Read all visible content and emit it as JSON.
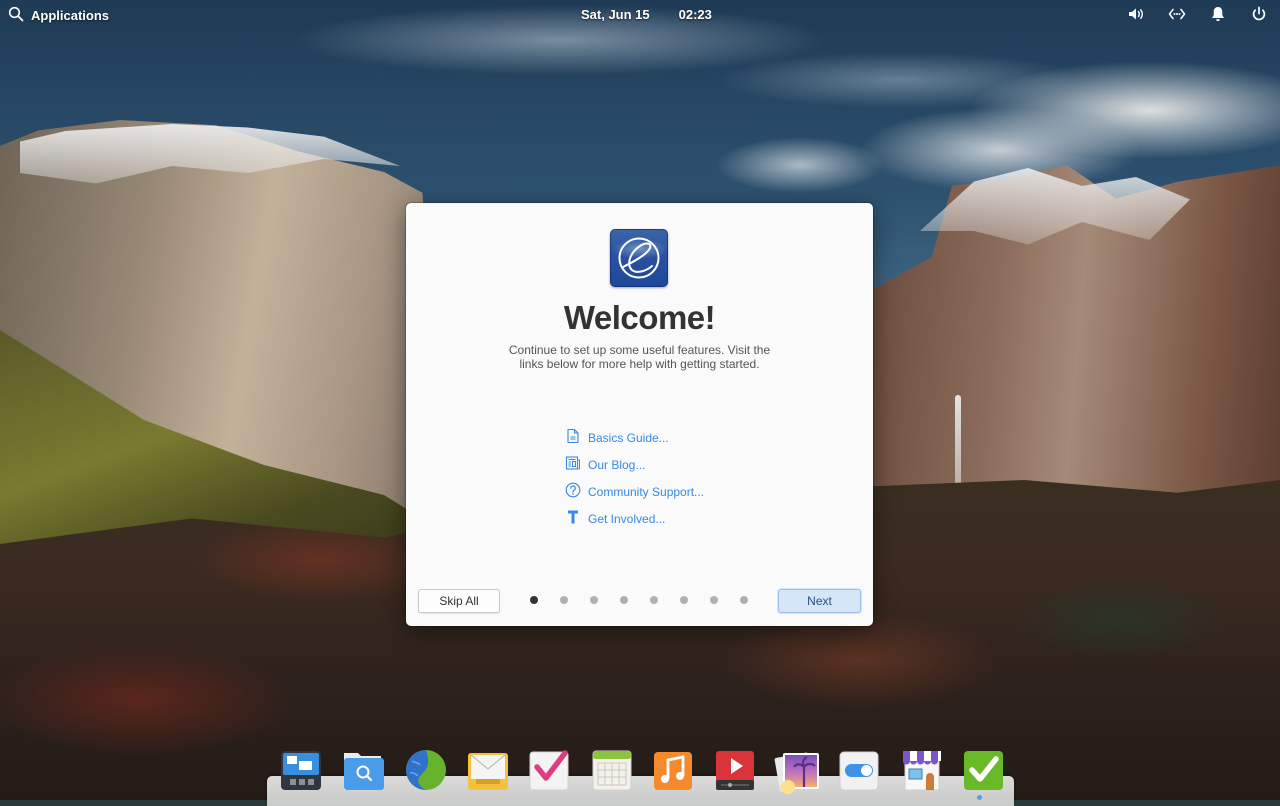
{
  "panel": {
    "applications_label": "Applications",
    "date": "Sat, Jun 15",
    "time": "02:23",
    "indicators": [
      {
        "icon": "volume-icon"
      },
      {
        "icon": "network-wired-icon"
      },
      {
        "icon": "notification-bell-icon"
      },
      {
        "icon": "power-icon"
      }
    ]
  },
  "dialog": {
    "logo_icon": "elementary-os-logo",
    "title": "Welcome!",
    "description": "Continue to set up some useful features. Visit the links below for more help with getting started.",
    "links": [
      {
        "label": "Basics Guide...",
        "icon": "document-icon"
      },
      {
        "label": "Our Blog...",
        "icon": "newspaper-icon"
      },
      {
        "label": "Community Support...",
        "icon": "help-circle-icon"
      },
      {
        "label": "Get Involved...",
        "icon": "hammer-icon"
      }
    ],
    "skip_label": "Skip All",
    "next_label": "Next",
    "pages_total": 8,
    "current_page": 1,
    "link_color": "#3689e6"
  },
  "dock": {
    "apps": [
      {
        "name": "Multitasking View",
        "icon": "multitasking-icon"
      },
      {
        "name": "Files",
        "icon": "files-icon"
      },
      {
        "name": "Web Browser",
        "icon": "browser-globe-icon"
      },
      {
        "name": "Mail",
        "icon": "mail-icon"
      },
      {
        "name": "Tasks",
        "icon": "tasks-check-icon"
      },
      {
        "name": "Calendar",
        "icon": "calendar-icon"
      },
      {
        "name": "Music",
        "icon": "music-icon"
      },
      {
        "name": "Videos",
        "icon": "videos-play-icon"
      },
      {
        "name": "Photos",
        "icon": "photos-icon"
      },
      {
        "name": "System Settings",
        "icon": "settings-toggle-icon"
      },
      {
        "name": "AppCenter",
        "icon": "appcenter-store-icon"
      },
      {
        "name": "Initial Setup",
        "icon": "green-checkmark-icon",
        "running": true
      }
    ]
  }
}
